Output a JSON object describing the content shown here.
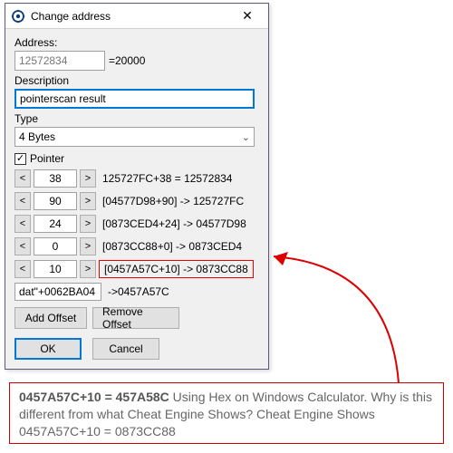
{
  "window": {
    "title": "Change address",
    "close": "✕"
  },
  "address": {
    "label": "Address:",
    "value": "12572834",
    "equals": "=20000"
  },
  "description": {
    "label": "Description",
    "value": "pointerscan result"
  },
  "type": {
    "label": "Type",
    "value": "4 Bytes"
  },
  "pointer": {
    "label": "Pointer",
    "checked": "✓"
  },
  "offsets": [
    {
      "lt": "<",
      "value": "38",
      "gt": ">",
      "result": "125727FC+38 = 12572834"
    },
    {
      "lt": "<",
      "value": "90",
      "gt": ">",
      "result": "[04577D98+90] -> 125727FC"
    },
    {
      "lt": "<",
      "value": "24",
      "gt": ">",
      "result": "[0873CED4+24] -> 04577D98"
    },
    {
      "lt": "<",
      "value": "0",
      "gt": ">",
      "result": "[0873CC88+0] -> 0873CED4"
    },
    {
      "lt": "<",
      "value": "10",
      "gt": ">",
      "result": "[0457A57C+10] -> 0873CC88"
    }
  ],
  "base": {
    "value": "dat\"+0062BA04",
    "result": "->0457A57C"
  },
  "buttons": {
    "add": "Add Offset",
    "remove": "Remove Offset",
    "ok": "OK",
    "cancel": "Cancel"
  },
  "annotation": {
    "bold": "0457A57C+10 = 457A58C",
    "rest": " Using Hex on Windows Calculator. Why is this different from what Cheat Engine Shows? Cheat Engine Shows 0457A57C+10 = 0873CC88"
  }
}
